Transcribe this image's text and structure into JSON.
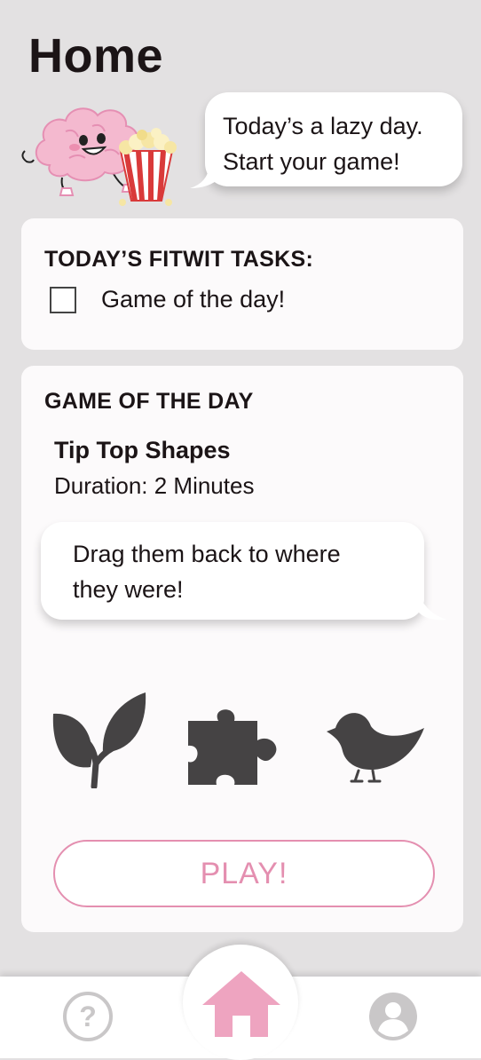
{
  "page": {
    "title": "Home"
  },
  "mascot_bubble": {
    "text": "Today’s a lazy day.\nStart your game!"
  },
  "tasks": {
    "heading": "TODAY’S FITWIT TASKS:",
    "items": [
      {
        "label": "Game of the day!",
        "checked": false
      }
    ]
  },
  "game": {
    "heading": "GAME OF THE DAY",
    "name": "Tip Top Shapes",
    "duration": "Duration: 2 Minutes",
    "instruction": "Drag them back to where\nthey were!",
    "shapes": [
      "leaf-sprout-icon",
      "puzzle-piece-icon",
      "bird-icon"
    ],
    "play_label": "PLAY!"
  },
  "nav": {
    "items": [
      {
        "name": "help",
        "icon": "question-circle-icon"
      },
      {
        "name": "home",
        "icon": "home-icon",
        "active": true
      },
      {
        "name": "profile",
        "icon": "user-circle-icon"
      }
    ]
  },
  "colors": {
    "accent": "#e48fb0",
    "shape": "#454344",
    "background": "#e3e1e2",
    "card": "#fcfafb"
  }
}
